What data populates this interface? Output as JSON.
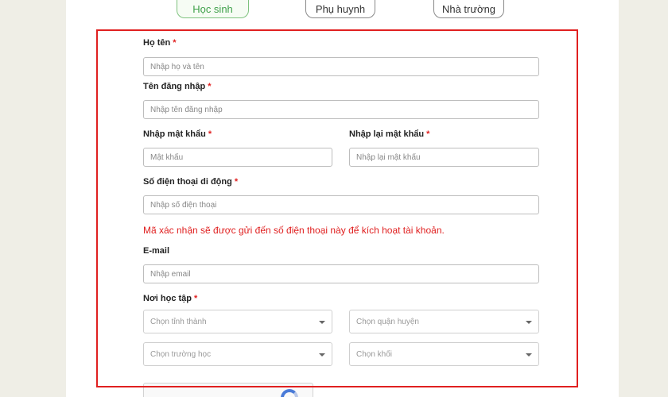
{
  "tabs": {
    "student": "Học sinh",
    "parent": "Phụ huynh",
    "school": "Nhà trường"
  },
  "required_mark": "*",
  "fields": {
    "fullname": {
      "label": "Họ tên",
      "placeholder": "Nhập họ và tên"
    },
    "username": {
      "label": "Tên đăng nhập",
      "placeholder": "Nhập tên đăng nhập"
    },
    "password": {
      "label": "Nhập mật khẩu",
      "placeholder": "Mật khẩu"
    },
    "password_confirm": {
      "label": "Nhập lại mật khẩu",
      "placeholder": "Nhập lại mật khẩu"
    },
    "phone": {
      "label": "Số điện thoại di động",
      "placeholder": "Nhập số điện thoại"
    },
    "email": {
      "label": "E-mail",
      "placeholder": "Nhập email"
    }
  },
  "phone_note": "Mã xác nhận sẽ được gửi đến số điện thoại này để kích hoạt tài khoản.",
  "location": {
    "label": "Nơi học tập",
    "province": "Chọn tỉnh thành",
    "district": "Chọn quận huyện",
    "school": "Chọn trường học",
    "grade": "Chọn khối"
  },
  "colors": {
    "required": "#e02020",
    "active_tab": "#3fa14a",
    "highlight": "#e02020"
  }
}
